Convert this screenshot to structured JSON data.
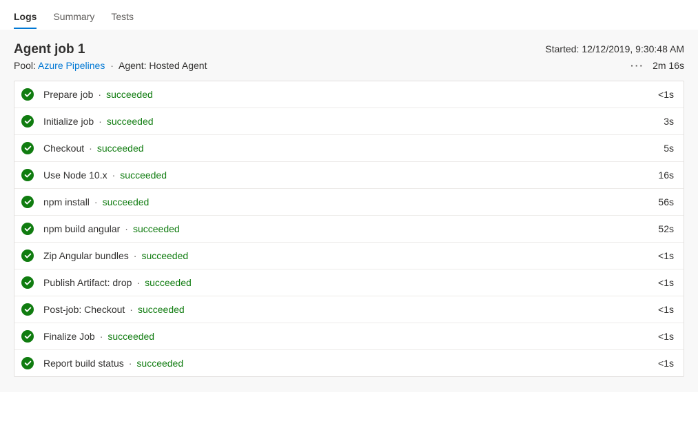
{
  "tabs": [
    {
      "label": "Logs",
      "active": true
    },
    {
      "label": "Summary",
      "active": false
    },
    {
      "label": "Tests",
      "active": false
    }
  ],
  "header": {
    "title": "Agent job 1",
    "started_label": "Started:",
    "started_value": "12/12/2019, 9:30:48 AM",
    "pool_label": "Pool:",
    "pool_link": "Azure Pipelines",
    "agent_label": "Agent:",
    "agent_value": "Hosted Agent",
    "total_duration": "2m 16s"
  },
  "status_text": "succeeded",
  "steps": [
    {
      "name": "Prepare job",
      "status": "succeeded",
      "duration": "<1s"
    },
    {
      "name": "Initialize job",
      "status": "succeeded",
      "duration": "3s"
    },
    {
      "name": "Checkout",
      "status": "succeeded",
      "duration": "5s"
    },
    {
      "name": "Use Node 10.x",
      "status": "succeeded",
      "duration": "16s"
    },
    {
      "name": "npm install",
      "status": "succeeded",
      "duration": "56s"
    },
    {
      "name": "npm build angular",
      "status": "succeeded",
      "duration": "52s"
    },
    {
      "name": "Zip Angular bundles",
      "status": "succeeded",
      "duration": "<1s"
    },
    {
      "name": "Publish Artifact: drop",
      "status": "succeeded",
      "duration": "<1s"
    },
    {
      "name": "Post-job: Checkout",
      "status": "succeeded",
      "duration": "<1s"
    },
    {
      "name": "Finalize Job",
      "status": "succeeded",
      "duration": "<1s"
    },
    {
      "name": "Report build status",
      "status": "succeeded",
      "duration": "<1s"
    }
  ]
}
